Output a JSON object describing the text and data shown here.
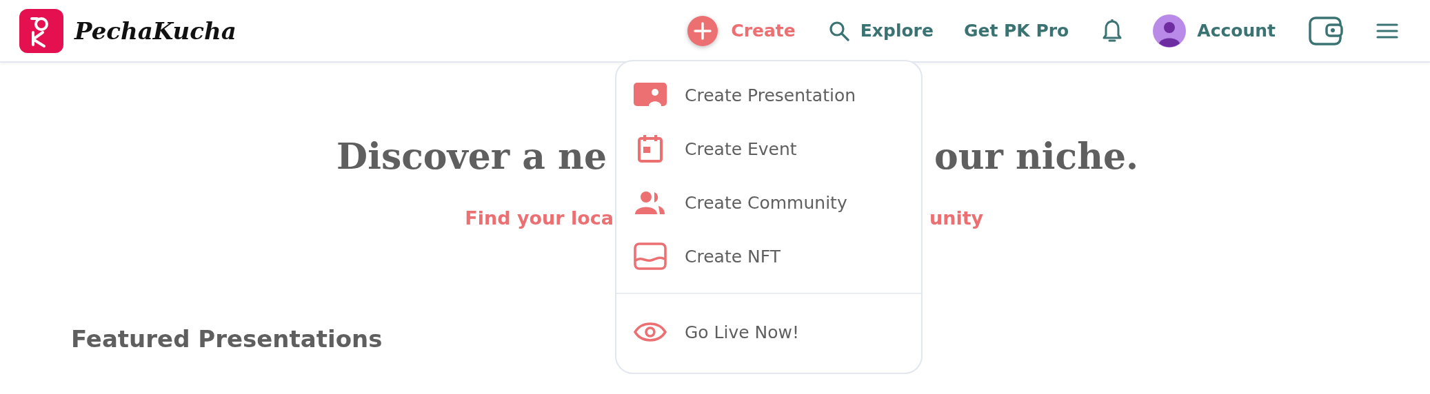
{
  "header": {
    "logo": {
      "wordmark": "PechaKucha"
    },
    "nav": [
      {
        "kind": "create",
        "label": "Create",
        "expanded": true
      },
      {
        "kind": "search",
        "label": "Explore"
      },
      {
        "kind": "text",
        "label": "Get PK Pro"
      },
      {
        "kind": "bell"
      },
      {
        "kind": "account",
        "label": "Account"
      },
      {
        "kind": "wallet"
      },
      {
        "kind": "menu"
      }
    ]
  },
  "create_menu": {
    "items": [
      {
        "kind": "presentation",
        "label": "Create Presentation",
        "divider_before": false
      },
      {
        "kind": "event",
        "label": "Create Event",
        "divider_before": false
      },
      {
        "kind": "community",
        "label": "Create Community",
        "divider_before": false
      },
      {
        "kind": "nft",
        "label": "Create NFT",
        "divider_before": false
      },
      {
        "kind": "live",
        "label": "Go Live Now!",
        "divider_before": true
      }
    ]
  },
  "hero": {
    "title_left": "Discover a ne",
    "title_right": "our niche.",
    "subtitle_left": "Find your loca",
    "subtitle_right": "unity"
  },
  "featured": {
    "heading": "Featured Presentations"
  }
}
